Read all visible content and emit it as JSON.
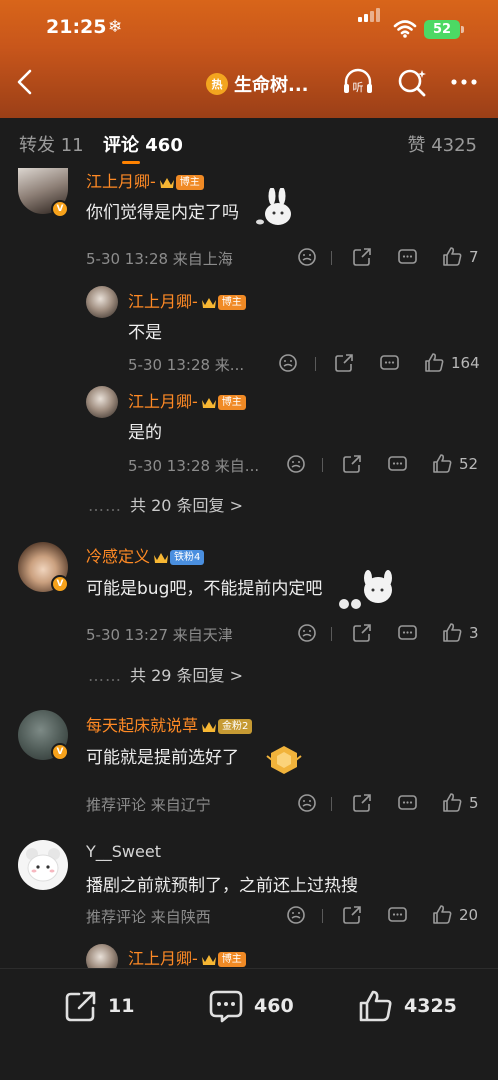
{
  "status": {
    "time": "21:25",
    "weather_icon": "snowflake-icon",
    "battery": "52"
  },
  "nav": {
    "title": "生命树...",
    "badge": "热"
  },
  "tabs": {
    "repost": "转发 11",
    "comment": "评论 460",
    "like": "赞 4325"
  },
  "comments": [
    {
      "name": "江上月卿-",
      "tag": "博主",
      "text": "你们觉得是内定了吗",
      "meta": "5-30 13:28  来自上海",
      "likes": "7"
    },
    {
      "name": "江上月卿-",
      "tag": "博主",
      "text": "不是",
      "meta": "5-30 13:28  来...",
      "likes": "164"
    },
    {
      "name": "江上月卿-",
      "tag": "博主",
      "text": "是的",
      "meta": "5-30 13:28  来自...",
      "likes": "52"
    },
    {
      "more": "共 20 条回复 >"
    },
    {
      "name": "冷感定义",
      "tag": "铁粉4",
      "text": "可能是bug吧，不能提前内定吧",
      "meta": "5-30 13:27  来自天津",
      "likes": "3"
    },
    {
      "more": "共 29 条回复 >"
    },
    {
      "name": "每天起床就说草",
      "tag": "金粉2",
      "text": "可能就是提前选好了",
      "meta": "推荐评论  来自辽宁",
      "likes": "5"
    },
    {
      "name": "Y__Sweet",
      "text": "播剧之前就预制了，之前还上过热搜",
      "meta": "推荐评论  来自陕西",
      "likes": "20"
    },
    {
      "name": "江上月卿-",
      "tag": "博主"
    }
  ],
  "bottom": {
    "reposts": "11",
    "comments": "460",
    "likes": "4325"
  }
}
